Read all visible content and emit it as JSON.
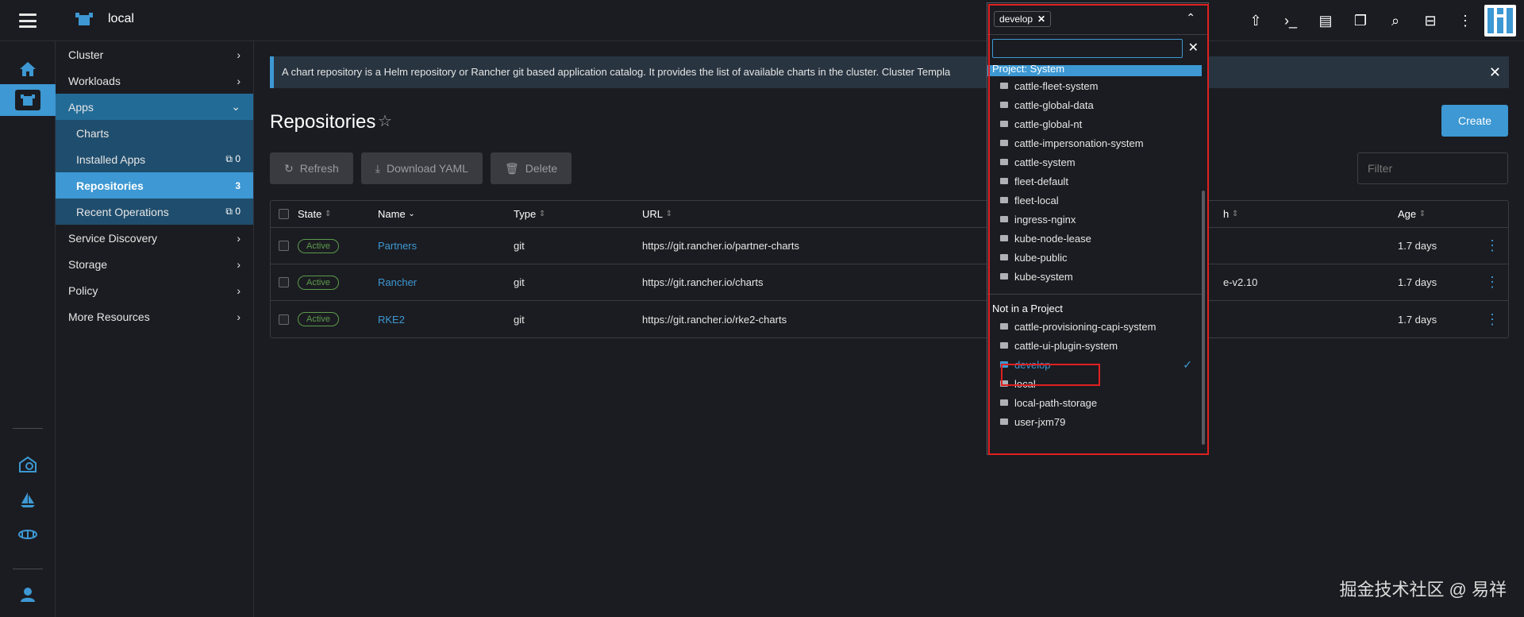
{
  "header": {
    "cluster_name": "local"
  },
  "sidebar": {
    "items": [
      {
        "label": "Cluster"
      },
      {
        "label": "Workloads"
      },
      {
        "label": "Apps"
      },
      {
        "label": "Charts"
      },
      {
        "label": "Installed Apps",
        "count": "0"
      },
      {
        "label": "Repositories",
        "count": "3"
      },
      {
        "label": "Recent Operations",
        "count": "0"
      },
      {
        "label": "Service Discovery"
      },
      {
        "label": "Storage"
      },
      {
        "label": "Policy"
      },
      {
        "label": "More Resources"
      }
    ]
  },
  "banner": {
    "text": "A chart repository is a Helm repository or Rancher git based application catalog. It provides the list of available charts in the cluster. Cluster Templa"
  },
  "page": {
    "title": "Repositories",
    "create_label": "Create",
    "refresh_label": "Refresh",
    "download_label": "Download YAML",
    "delete_label": "Delete",
    "filter_placeholder": "Filter"
  },
  "table": {
    "headers": {
      "state": "State",
      "name": "Name",
      "type": "Type",
      "url": "URL",
      "branch": "h",
      "age": "Age"
    },
    "rows": [
      {
        "state": "Active",
        "name": "Partners",
        "type": "git",
        "url": "https://git.rancher.io/partner-charts",
        "branch": "",
        "age": "1.7 days"
      },
      {
        "state": "Active",
        "name": "Rancher",
        "type": "git",
        "url": "https://git.rancher.io/charts",
        "branch": "e-v2.10",
        "age": "1.7 days"
      },
      {
        "state": "Active",
        "name": "RKE2",
        "type": "git",
        "url": "https://git.rancher.io/rke2-charts",
        "branch": "",
        "age": "1.7 days"
      }
    ]
  },
  "namespace_dropdown": {
    "selected_tag": "develop",
    "groups": [
      {
        "label": "Project: System",
        "items": [
          "cattle-fleet-system",
          "cattle-global-data",
          "cattle-global-nt",
          "cattle-impersonation-system",
          "cattle-system",
          "fleet-default",
          "fleet-local",
          "ingress-nginx",
          "kube-node-lease",
          "kube-public",
          "kube-system"
        ]
      },
      {
        "label": "Not in a Project",
        "items": [
          "cattle-provisioning-capi-system",
          "cattle-ui-plugin-system",
          "develop",
          "local",
          "local-path-storage",
          "user-jxm79"
        ]
      }
    ],
    "selected_item": "develop"
  },
  "watermark": "掘金技术社区 @ 易祥",
  "colors": {
    "accent": "#3d98d3",
    "active_badge": "#5d9b4c",
    "highlight_box": "#e02020"
  }
}
